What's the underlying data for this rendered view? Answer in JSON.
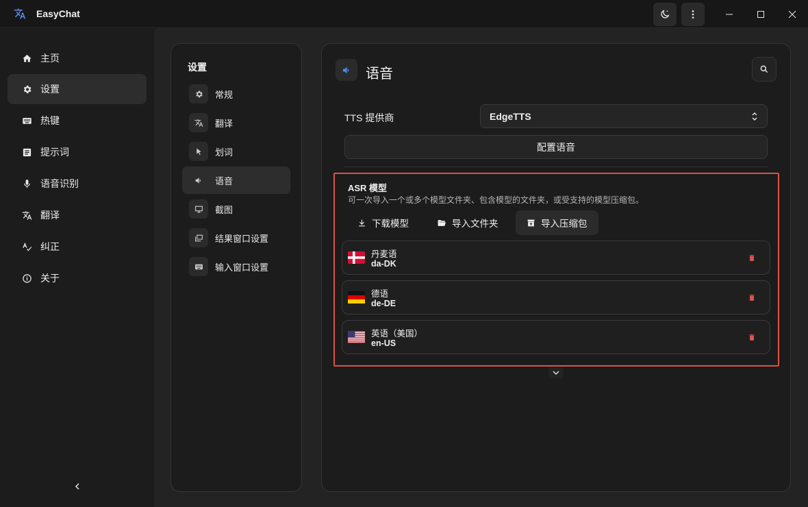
{
  "app": {
    "title": "EasyChat"
  },
  "sidebar": {
    "items": [
      {
        "label": "主页",
        "icon": "home-icon"
      },
      {
        "label": "设置",
        "icon": "gear-icon",
        "active": true
      },
      {
        "label": "热键",
        "icon": "keyboard-icon"
      },
      {
        "label": "提示词",
        "icon": "document-icon"
      },
      {
        "label": "语音识别",
        "icon": "microphone-icon"
      },
      {
        "label": "翻译",
        "icon": "translate-icon"
      },
      {
        "label": "纠正",
        "icon": "spellcheck-icon"
      },
      {
        "label": "关于",
        "icon": "info-icon"
      }
    ]
  },
  "settings_menu": {
    "title": "设置",
    "items": [
      {
        "label": "常规",
        "icon": "gear-icon"
      },
      {
        "label": "翻译",
        "icon": "translate-icon"
      },
      {
        "label": "划词",
        "icon": "cursor-icon"
      },
      {
        "label": "语音",
        "icon": "speaker-icon",
        "active": true
      },
      {
        "label": "截图",
        "icon": "monitor-icon"
      },
      {
        "label": "结果窗口设置",
        "icon": "window-icon"
      },
      {
        "label": "输入窗口设置",
        "icon": "keyboard-icon"
      }
    ]
  },
  "page": {
    "title": "语音",
    "tts": {
      "label": "TTS 提供商",
      "value": "EdgeTTS",
      "config_button": "配置语音"
    },
    "asr": {
      "title": "ASR 模型",
      "description": "可一次导入一个或多个模型文件夹、包含模型的文件夹，或受支持的模型压缩包。",
      "actions": [
        {
          "label": "下载模型",
          "icon": "download-icon"
        },
        {
          "label": "导入文件夹",
          "icon": "folder-open-icon"
        },
        {
          "label": "导入压缩包",
          "icon": "archive-icon"
        }
      ],
      "models": [
        {
          "name": "丹麦语",
          "code": "da-DK",
          "flag": "denmark-flag"
        },
        {
          "name": "德语",
          "code": "de-DE",
          "flag": "germany-flag"
        },
        {
          "name": "英语（美国）",
          "code": "en-US",
          "flag": "usa-flag"
        }
      ]
    }
  },
  "colors": {
    "accent": "#4a8cf0",
    "highlight_border": "#e0523b",
    "delete": "#d9534f"
  }
}
